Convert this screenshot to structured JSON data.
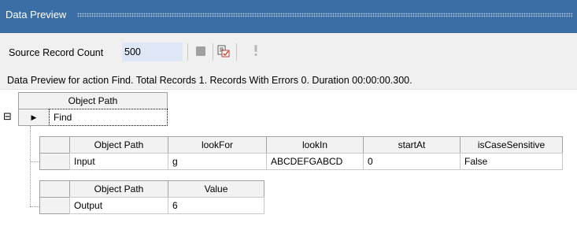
{
  "window": {
    "title": "Data Preview"
  },
  "toolbar": {
    "record_count_label": "Source Record Count",
    "record_count_value": "500",
    "icons": [
      "stop-icon",
      "preview-validate-icon",
      "info-icon"
    ]
  },
  "info": {
    "message": "Data Preview for action Find. Total Records 1. Records With Errors 0. Duration 00:00:00.300."
  },
  "grid": {
    "root_header": "Object Path",
    "root_row": "Find",
    "input_table": {
      "headers": [
        "Object Path",
        "lookFor",
        "lookIn",
        "startAt",
        "isCaseSensitive"
      ],
      "row": [
        "Input",
        "g",
        "ABCDEFGABCD",
        "0",
        "False"
      ]
    },
    "output_table": {
      "headers": [
        "Object Path",
        "Value"
      ],
      "row": [
        "Output",
        "6"
      ]
    },
    "expander": "⊟",
    "row_indicator": "▶"
  },
  "colors": {
    "titlebar": "#3a6ea5",
    "toolbar_bg": "#f0f0f0",
    "input_bg": "#dde7f5"
  }
}
